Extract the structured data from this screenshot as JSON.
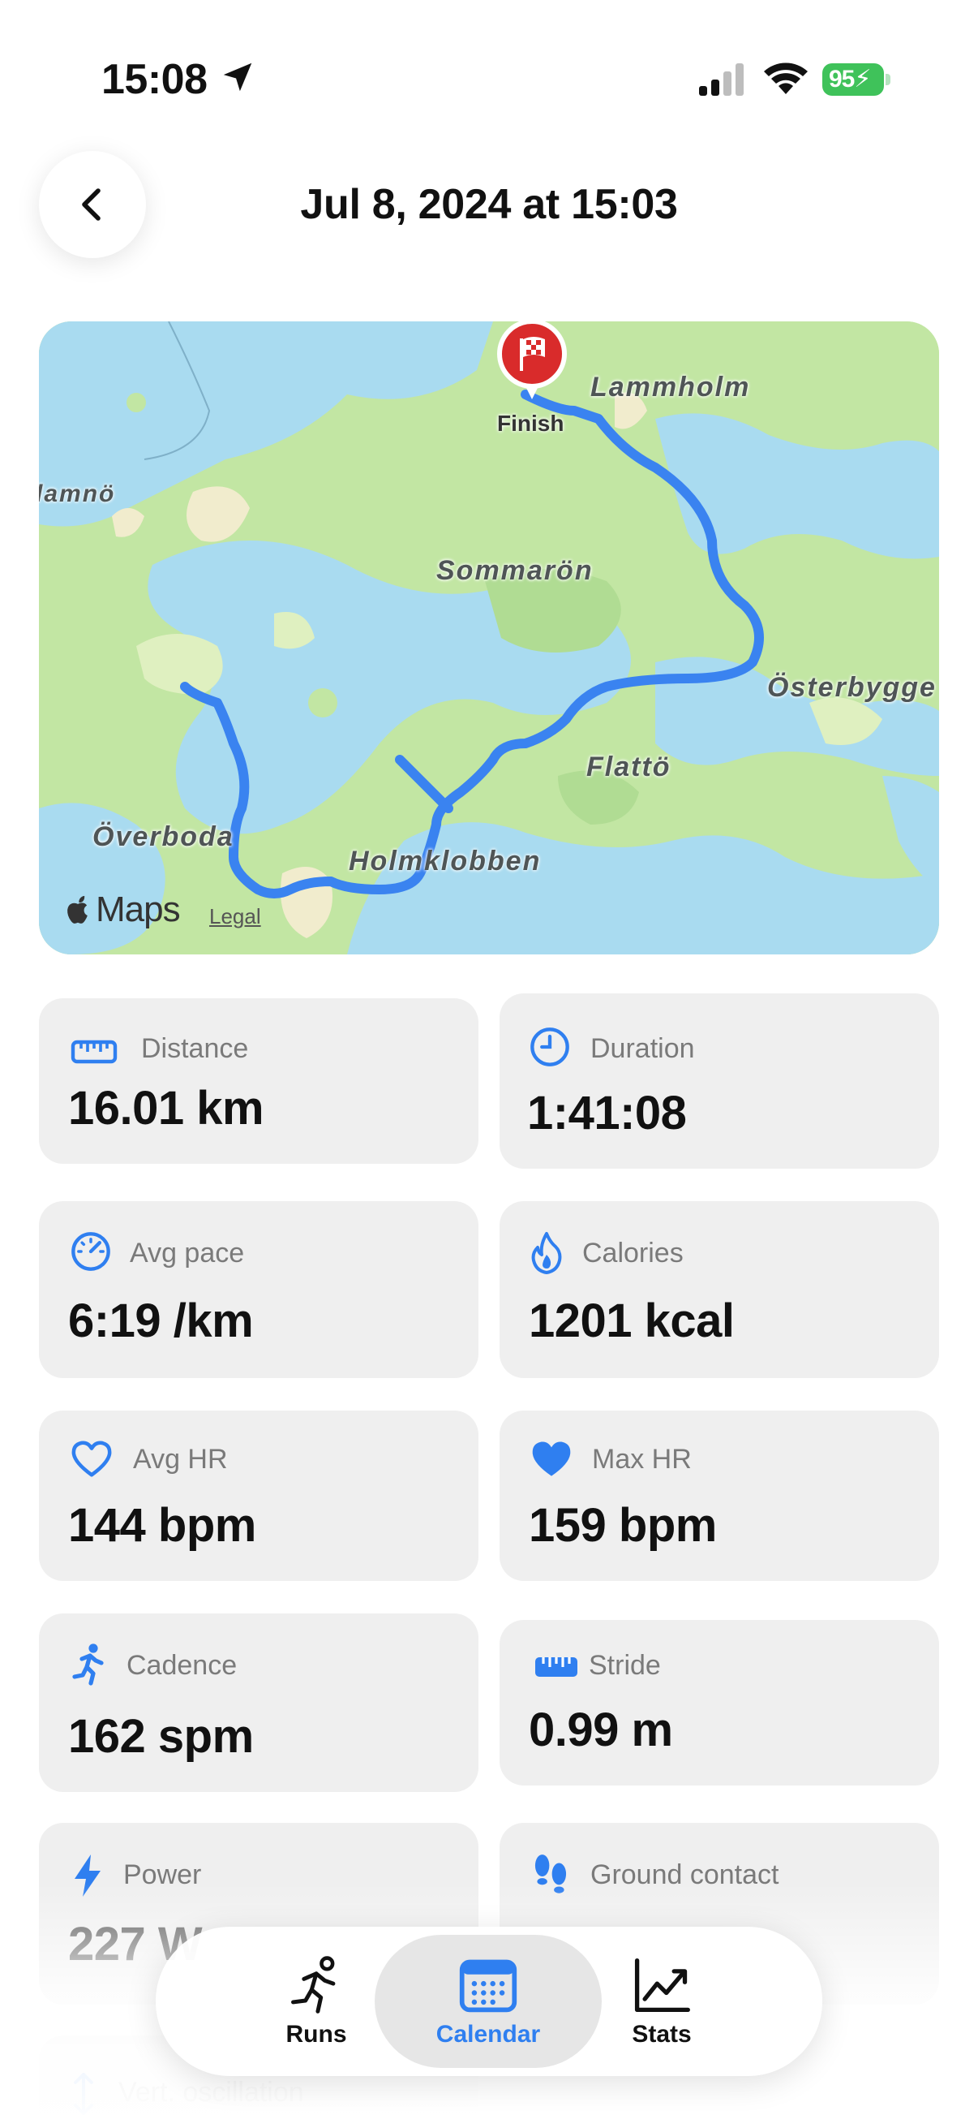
{
  "status_bar": {
    "time": "15:08",
    "battery": "95",
    "location_icon": "location-arrow-icon",
    "signal_icon": "cellular-signal-icon",
    "wifi_icon": "wifi-icon"
  },
  "header": {
    "title": "Jul 8, 2024 at 15:03",
    "back_icon": "chevron-left-icon"
  },
  "map": {
    "finish_label": "Finish",
    "places": [
      "Lammholm",
      "Sommarön",
      "Österbygge",
      "Flattö",
      "Överboda",
      "Holmklobben",
      "lamnö"
    ],
    "attribution": "Maps",
    "legal": "Legal",
    "route_color": "#3a83f0"
  },
  "stats": [
    {
      "label": "Distance",
      "value": "16.01 km",
      "icon": "ruler-icon"
    },
    {
      "label": "Duration",
      "value": "1:41:08",
      "icon": "clock-icon"
    },
    {
      "label": "Avg pace",
      "value": "6:19 /km",
      "icon": "speedometer-icon"
    },
    {
      "label": "Calories",
      "value": "1201 kcal",
      "icon": "flame-icon"
    },
    {
      "label": "Avg HR",
      "value": "144 bpm",
      "icon": "heart-outline-icon"
    },
    {
      "label": "Max HR",
      "value": "159 bpm",
      "icon": "heart-filled-icon"
    },
    {
      "label": "Cadence",
      "value": "162 spm",
      "icon": "runner-icon"
    },
    {
      "label": "Stride",
      "value": "0.99 m",
      "icon": "ruler-icon"
    },
    {
      "label": "Power",
      "value": "227 W",
      "icon": "bolt-icon"
    },
    {
      "label": "Ground contact",
      "value": "",
      "icon": "footprints-icon"
    },
    {
      "label": "Vert. oscillation",
      "value": "",
      "icon": "vertical-arrows-icon"
    }
  ],
  "tab_bar": {
    "tabs": [
      {
        "label": "Runs",
        "icon": "running-figure-icon",
        "active": false
      },
      {
        "label": "Calendar",
        "icon": "calendar-icon",
        "active": true
      },
      {
        "label": "Stats",
        "icon": "chart-line-icon",
        "active": false
      }
    ],
    "accent_color": "#2f7ff0"
  }
}
